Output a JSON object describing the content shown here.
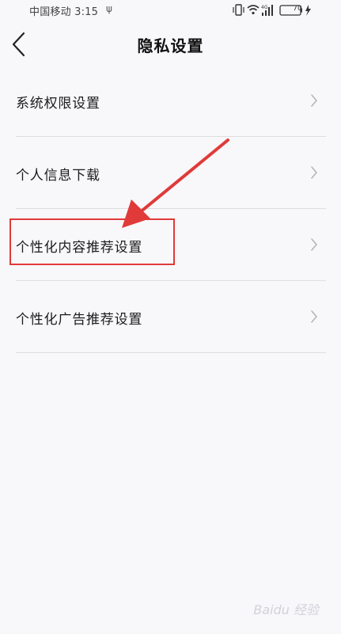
{
  "status_bar": {
    "carrier_time": "中国移动 3:15",
    "usb_symbol": "ψ",
    "battery": "70"
  },
  "header": {
    "title": "隐私设置"
  },
  "menu": {
    "items": [
      {
        "label": "系统权限设置"
      },
      {
        "label": "个人信息下载"
      },
      {
        "label": "个性化内容推荐设置"
      },
      {
        "label": "个性化广告推荐设置"
      }
    ]
  },
  "annotation": {
    "highlight_color": "#e03a3a"
  },
  "watermark": {
    "text": "Baidu 经验"
  }
}
